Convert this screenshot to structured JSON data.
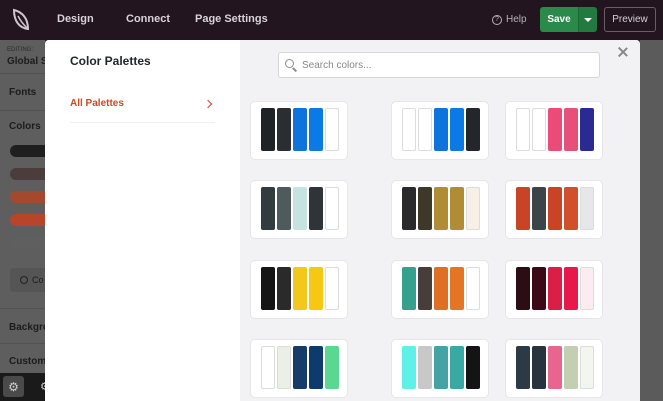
{
  "topbar": {
    "nav": [
      "Design",
      "Connect",
      "Page Settings"
    ],
    "help": "Help",
    "save": "Save",
    "preview": "Preview"
  },
  "left_panel": {
    "editing": "EDITING:",
    "global": "Global S",
    "fonts": "Fonts",
    "colors": "Colors",
    "swatches": [
      "#1f1f1f",
      "#4a3d3b",
      "#a34a2e",
      "#b8442a",
      "#5f5f5f"
    ],
    "customize": "Co",
    "background": "Backgro",
    "custom": "Custom"
  },
  "modal": {
    "title": "Color Palettes",
    "side_item": "All Palettes",
    "search_placeholder": "Search colors...",
    "palettes": [
      [
        "#1f2326",
        "#2a2d31",
        "#0f73dd",
        "#0c7ae6",
        "#ffffff"
      ],
      [
        "#ffffff",
        "#ffffff",
        "#0f73dd",
        "#0c7ae6",
        "#23272b"
      ],
      [
        "#ffffff",
        "#ffffff",
        "#ec4a77",
        "#e8507c",
        "#2b2a92"
      ],
      [
        "#323b3f",
        "#4f5a5d",
        "#c5e3e0",
        "#2e3437",
        "#ffffff"
      ],
      [
        "#2a2a2c",
        "#3d3828",
        "#b08d35",
        "#b08d35",
        "#f6f0e6"
      ],
      [
        "#c94426",
        "#3c4449",
        "#c94426",
        "#d14f2a",
        "#e6e7e9"
      ],
      [
        "#151515",
        "#2a2a2a",
        "#f2c81c",
        "#f7c812",
        "#ffffff"
      ],
      [
        "#35a08d",
        "#473e3b",
        "#de6f25",
        "#e67425",
        "#ffffff"
      ],
      [
        "#2c0d14",
        "#3a0a17",
        "#d91f45",
        "#e8184b",
        "#fdecef"
      ],
      [
        "#ffffff",
        "#eaf0e5",
        "#173c6a",
        "#0f3a6e",
        "#5ad892"
      ],
      [
        "#5ff0e8",
        "#c8c8c8",
        "#46a3a4",
        "#3aa8a3",
        "#141414"
      ],
      [
        "#2b3a45",
        "#27343e",
        "#e66690",
        "#c3cfb0",
        "#f3f5ef"
      ]
    ]
  }
}
